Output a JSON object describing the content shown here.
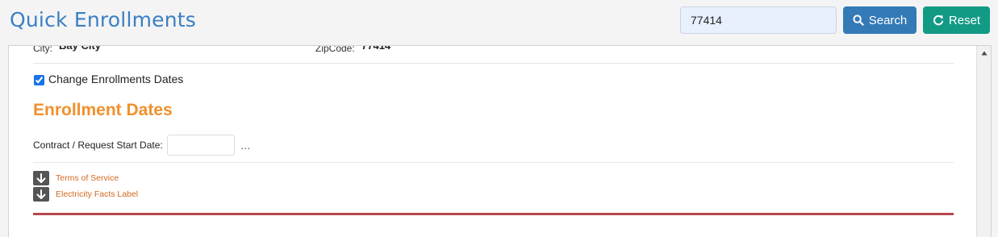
{
  "header": {
    "title": "Quick Enrollments",
    "search_value": "77414",
    "search_button": "Search",
    "reset_button": "Reset"
  },
  "address": {
    "city_label": "City:",
    "city_value": "Bay City",
    "zip_label": "ZipCode:",
    "zip_value": "77414"
  },
  "change_dates": {
    "label": "Change Enrollments Dates",
    "checked": true
  },
  "enrollment": {
    "section_title": "Enrollment Dates",
    "start_date_label": "Contract / Request Start Date:",
    "start_date_value": "",
    "picker_glyph": "…"
  },
  "documents": [
    {
      "label": "Terms of Service",
      "icon": "download-icon"
    },
    {
      "label": "Electricity Facts Label",
      "icon": "download-icon"
    }
  ],
  "colors": {
    "title": "#3a7fc4",
    "search_button": "#337ab7",
    "reset_button": "#139a85",
    "section_title": "#f0902c",
    "link": "#d2691e",
    "divider_red": "#b5474b"
  }
}
